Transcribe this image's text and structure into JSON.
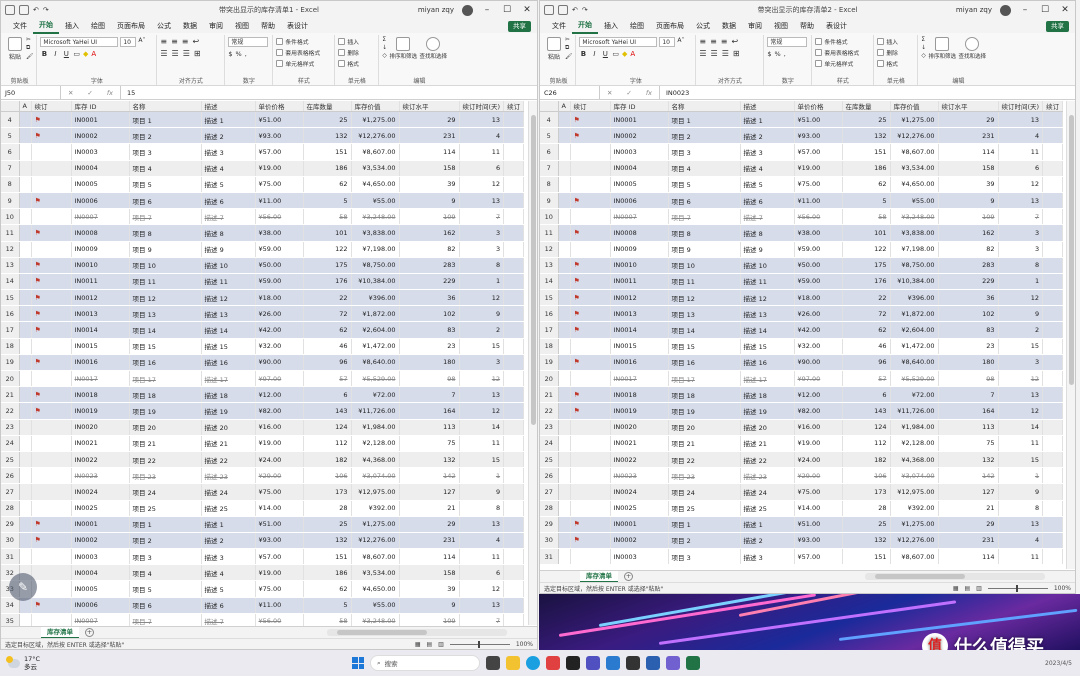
{
  "window1": {
    "title": "带突出显示的库存清单1 - Excel",
    "user": "miyan zqy",
    "namebox": "J50",
    "formula": "15",
    "rows": [
      4,
      5,
      6,
      7,
      8,
      9,
      10,
      11,
      12,
      13,
      14,
      15,
      16,
      17,
      18,
      19,
      20,
      21,
      22,
      23,
      24,
      25,
      26,
      27,
      28,
      29,
      30,
      31,
      32,
      33,
      34,
      35
    ],
    "status": "选定目标区域，然后按 ENTER 或选择\"粘贴\"",
    "zoom": "100%"
  },
  "window2": {
    "title": "带突出显示的库存清单2 - Excel",
    "user": "miyan zqy",
    "namebox": "C26",
    "formula": "IN0023",
    "rows": [
      4,
      5,
      6,
      7,
      8,
      9,
      10,
      11,
      12,
      13,
      14,
      15,
      16,
      17,
      18,
      19,
      20,
      21,
      22,
      23,
      24,
      25,
      26,
      27,
      28,
      29,
      30,
      31
    ],
    "status": "选定目标区域，然后按 ENTER 或选择\"粘贴\"",
    "zoom": "100%"
  },
  "menu": [
    "文件",
    "开始",
    "插入",
    "绘图",
    "页面布局",
    "公式",
    "数据",
    "审阅",
    "视图",
    "帮助",
    "表设计"
  ],
  "share": "共享",
  "ribbon": {
    "paste": "粘贴",
    "clipboard": "剪贴板",
    "font_name": "Microsoft YaHei UI",
    "font_size": "10",
    "font_group": "字体",
    "align_group": "对齐方式",
    "number_format": "常规",
    "number_group": "数字",
    "cond_format": "条件格式",
    "table_format": "套用表格格式",
    "cell_style": "单元格样式",
    "styles_group": "样式",
    "insert": "插入",
    "delete": "删除",
    "format": "格式",
    "cells_group": "单元格",
    "sort_filter": "排序和筛选",
    "find_select": "查找和选择",
    "edit_group": "编辑"
  },
  "headers": [
    "A",
    "续订",
    "库存 ID",
    "名称",
    "描述",
    "单价价格",
    "在库数量",
    "库存价值",
    "续订水平",
    "续订时间(天)",
    "续订"
  ],
  "records": [
    {
      "flag": true,
      "id": "IN0001",
      "name": "项目 1",
      "desc": "描述 1",
      "price": "¥51.00",
      "qty": "25",
      "value": "¥1,275.00",
      "level": "29",
      "days": "13",
      "style": "alt"
    },
    {
      "flag": true,
      "id": "IN0002",
      "name": "项目 2",
      "desc": "描述 2",
      "price": "¥93.00",
      "qty": "132",
      "value": "¥12,276.00",
      "level": "231",
      "days": "4",
      "style": "alt"
    },
    {
      "flag": false,
      "id": "IN0003",
      "name": "项目 3",
      "desc": "描述 3",
      "price": "¥57.00",
      "qty": "151",
      "value": "¥8,607.00",
      "level": "114",
      "days": "11",
      "style": "plain"
    },
    {
      "flag": false,
      "id": "IN0004",
      "name": "项目 4",
      "desc": "描述 4",
      "price": "¥19.00",
      "qty": "186",
      "value": "¥3,534.00",
      "level": "158",
      "days": "6",
      "style": "even"
    },
    {
      "flag": false,
      "id": "IN0005",
      "name": "项目 5",
      "desc": "描述 5",
      "price": "¥75.00",
      "qty": "62",
      "value": "¥4,650.00",
      "level": "39",
      "days": "12",
      "style": "plain"
    },
    {
      "flag": true,
      "id": "IN0006",
      "name": "项目 6",
      "desc": "描述 6",
      "price": "¥11.00",
      "qty": "5",
      "value": "¥55.00",
      "level": "9",
      "days": "13",
      "style": "alt"
    },
    {
      "flag": false,
      "id": "IN0007",
      "name": "项目 7",
      "desc": "描述 7",
      "price": "¥56.00",
      "qty": "58",
      "value": "¥3,248.00",
      "level": "109",
      "days": "7",
      "style": "strike"
    },
    {
      "flag": true,
      "id": "IN0008",
      "name": "项目 8",
      "desc": "描述 8",
      "price": "¥38.00",
      "qty": "101",
      "value": "¥3,838.00",
      "level": "162",
      "days": "3",
      "style": "alt"
    },
    {
      "flag": false,
      "id": "IN0009",
      "name": "项目 9",
      "desc": "描述 9",
      "price": "¥59.00",
      "qty": "122",
      "value": "¥7,198.00",
      "level": "82",
      "days": "3",
      "style": "plain"
    },
    {
      "flag": true,
      "id": "IN0010",
      "name": "项目 10",
      "desc": "描述 10",
      "price": "¥50.00",
      "qty": "175",
      "value": "¥8,750.00",
      "level": "283",
      "days": "8",
      "style": "alt"
    },
    {
      "flag": true,
      "id": "IN0011",
      "name": "项目 11",
      "desc": "描述 11",
      "price": "¥59.00",
      "qty": "176",
      "value": "¥10,384.00",
      "level": "229",
      "days": "1",
      "style": "alt"
    },
    {
      "flag": true,
      "id": "IN0012",
      "name": "项目 12",
      "desc": "描述 12",
      "price": "¥18.00",
      "qty": "22",
      "value": "¥396.00",
      "level": "36",
      "days": "12",
      "style": "alt"
    },
    {
      "flag": true,
      "id": "IN0013",
      "name": "项目 13",
      "desc": "描述 13",
      "price": "¥26.00",
      "qty": "72",
      "value": "¥1,872.00",
      "level": "102",
      "days": "9",
      "style": "alt"
    },
    {
      "flag": true,
      "id": "IN0014",
      "name": "项目 14",
      "desc": "描述 14",
      "price": "¥42.00",
      "qty": "62",
      "value": "¥2,604.00",
      "level": "83",
      "days": "2",
      "style": "alt"
    },
    {
      "flag": false,
      "id": "IN0015",
      "name": "项目 15",
      "desc": "描述 15",
      "price": "¥32.00",
      "qty": "46",
      "value": "¥1,472.00",
      "level": "23",
      "days": "15",
      "style": "plain"
    },
    {
      "flag": true,
      "id": "IN0016",
      "name": "项目 16",
      "desc": "描述 16",
      "price": "¥90.00",
      "qty": "96",
      "value": "¥8,640.00",
      "level": "180",
      "days": "3",
      "style": "alt"
    },
    {
      "flag": false,
      "id": "IN0017",
      "name": "项目 17",
      "desc": "描述 17",
      "price": "¥97.00",
      "qty": "57",
      "value": "¥5,529.00",
      "level": "98",
      "days": "12",
      "style": "strike"
    },
    {
      "flag": true,
      "id": "IN0018",
      "name": "项目 18",
      "desc": "描述 18",
      "price": "¥12.00",
      "qty": "6",
      "value": "¥72.00",
      "level": "7",
      "days": "13",
      "style": "alt"
    },
    {
      "flag": true,
      "id": "IN0019",
      "name": "项目 19",
      "desc": "描述 19",
      "price": "¥82.00",
      "qty": "143",
      "value": "¥11,726.00",
      "level": "164",
      "days": "12",
      "style": "alt"
    },
    {
      "flag": false,
      "id": "IN0020",
      "name": "项目 20",
      "desc": "描述 20",
      "price": "¥16.00",
      "qty": "124",
      "value": "¥1,984.00",
      "level": "113",
      "days": "14",
      "style": "even"
    },
    {
      "flag": false,
      "id": "IN0021",
      "name": "项目 21",
      "desc": "描述 21",
      "price": "¥19.00",
      "qty": "112",
      "value": "¥2,128.00",
      "level": "75",
      "days": "11",
      "style": "plain"
    },
    {
      "flag": false,
      "id": "IN0022",
      "name": "项目 22",
      "desc": "描述 22",
      "price": "¥24.00",
      "qty": "182",
      "value": "¥4,368.00",
      "level": "132",
      "days": "15",
      "style": "even"
    },
    {
      "flag": false,
      "id": "IN0023",
      "name": "项目 23",
      "desc": "描述 23",
      "price": "¥29.00",
      "qty": "106",
      "value": "¥3,074.00",
      "level": "142",
      "days": "1",
      "style": "strike"
    },
    {
      "flag": false,
      "id": "IN0024",
      "name": "项目 24",
      "desc": "描述 24",
      "price": "¥75.00",
      "qty": "173",
      "value": "¥12,975.00",
      "level": "127",
      "days": "9",
      "style": "even"
    },
    {
      "flag": false,
      "id": "IN0025",
      "name": "项目 25",
      "desc": "描述 25",
      "price": "¥14.00",
      "qty": "28",
      "value": "¥392.00",
      "level": "21",
      "days": "8",
      "style": "plain"
    },
    {
      "flag": true,
      "id": "IN0001",
      "name": "项目 1",
      "desc": "描述 1",
      "price": "¥51.00",
      "qty": "25",
      "value": "¥1,275.00",
      "level": "29",
      "days": "13",
      "style": "alt"
    },
    {
      "flag": true,
      "id": "IN0002",
      "name": "项目 2",
      "desc": "描述 2",
      "price": "¥93.00",
      "qty": "132",
      "value": "¥12,276.00",
      "level": "231",
      "days": "4",
      "style": "alt"
    },
    {
      "flag": false,
      "id": "IN0003",
      "name": "项目 3",
      "desc": "描述 3",
      "price": "¥57.00",
      "qty": "151",
      "value": "¥8,607.00",
      "level": "114",
      "days": "11",
      "style": "plain"
    },
    {
      "flag": false,
      "id": "IN0004",
      "name": "项目 4",
      "desc": "描述 4",
      "price": "¥19.00",
      "qty": "186",
      "value": "¥3,534.00",
      "level": "158",
      "days": "6",
      "style": "even"
    },
    {
      "flag": false,
      "id": "IN0005",
      "name": "项目 5",
      "desc": "描述 5",
      "price": "¥75.00",
      "qty": "62",
      "value": "¥4,650.00",
      "level": "39",
      "days": "12",
      "style": "plain"
    },
    {
      "flag": true,
      "id": "IN0006",
      "name": "项目 6",
      "desc": "描述 6",
      "price": "¥11.00",
      "qty": "5",
      "value": "¥55.00",
      "level": "9",
      "days": "13",
      "style": "alt"
    },
    {
      "flag": false,
      "id": "IN0007",
      "name": "项目 7",
      "desc": "描述 7",
      "price": "¥56.00",
      "qty": "58",
      "value": "¥3,248.00",
      "level": "109",
      "days": "7",
      "style": "strike"
    }
  ],
  "sheet_tab": "库存清单",
  "taskbar": {
    "temp": "17°C",
    "weather": "多云",
    "search": "搜索",
    "date": "2023/4/5"
  },
  "watermark": "什么值得买",
  "colors": {
    "accent": "#217346",
    "alt_row": "#d6dcea",
    "flag": "#c0392b"
  }
}
